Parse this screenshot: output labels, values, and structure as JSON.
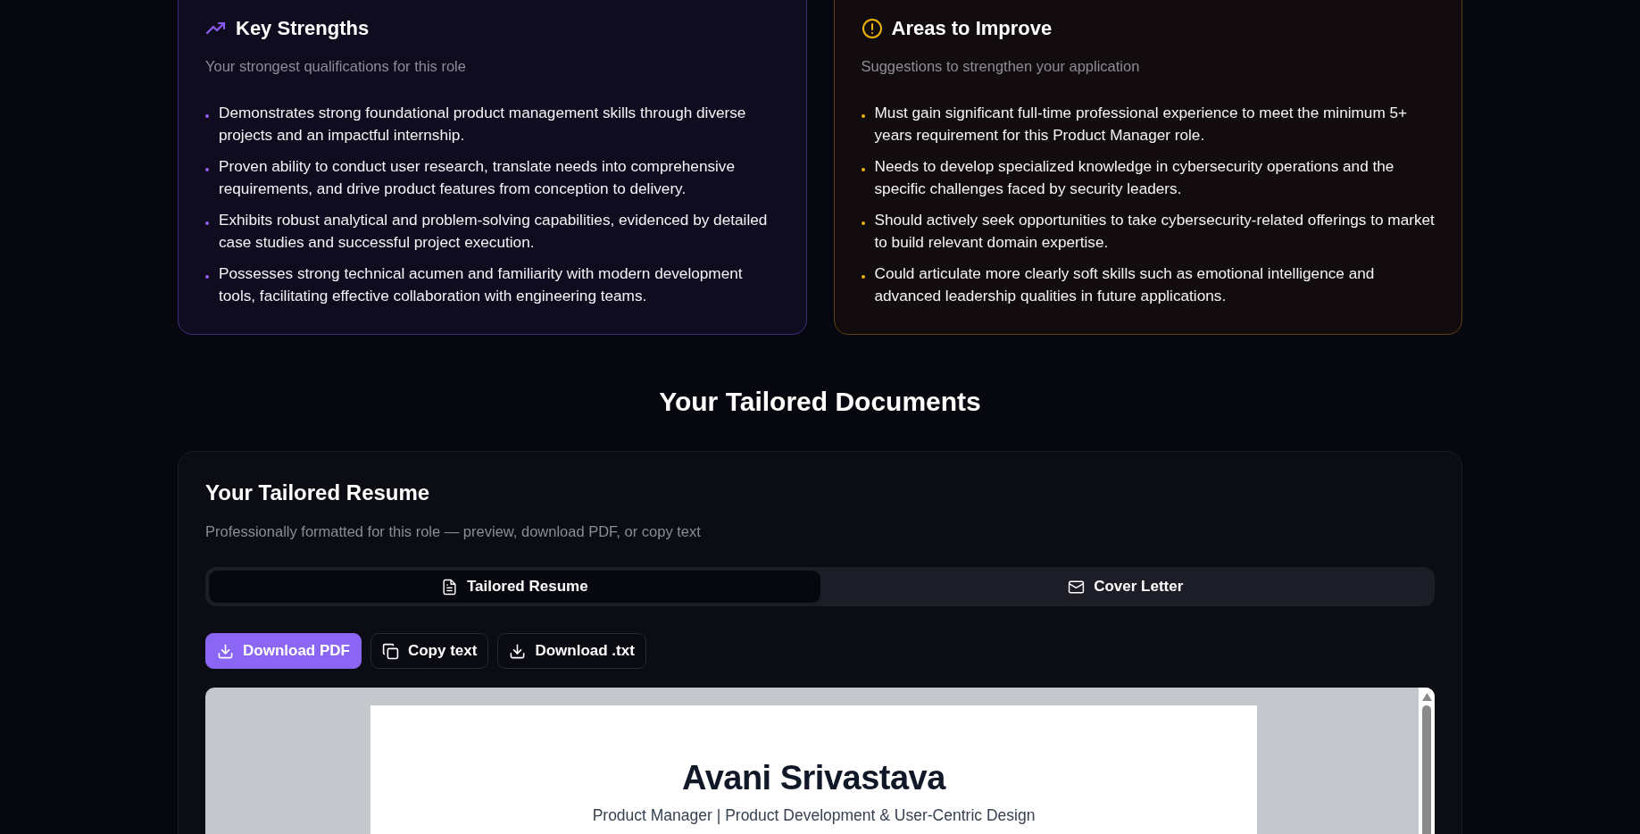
{
  "insight_cards": [
    {
      "kind": "strengths",
      "title": "Key Strengths",
      "subtitle": "Your strongest qualifications for this role",
      "items": [
        "Demonstrates strong foundational product management skills through diverse projects and an impactful internship.",
        "Proven ability to conduct user research, translate needs into comprehensive requirements, and drive product features from conception to delivery.",
        "Exhibits robust analytical and problem-solving capabilities, evidenced by detailed case studies and successful project execution.",
        "Possesses strong technical acumen and familiarity with modern development tools, facilitating effective collaboration with engineering teams."
      ]
    },
    {
      "kind": "improve",
      "title": "Areas to Improve",
      "subtitle": "Suggestions to strengthen your application",
      "items": [
        "Must gain significant full-time professional experience to meet the minimum 5+ years requirement for this Product Manager role.",
        "Needs to develop specialized knowledge in cybersecurity operations and the specific challenges faced by security leaders.",
        "Should actively seek opportunities to take cybersecurity-related offerings to market to build relevant domain expertise.",
        "Could articulate more clearly soft skills such as emotional intelligence and advanced leadership qualities in future applications."
      ]
    }
  ],
  "section_heading": "Your Tailored Documents",
  "documents": {
    "title": "Your Tailored Resume",
    "subtitle": "Professionally formatted for this role — preview, download PDF, or copy text",
    "tabs": [
      {
        "kind": "document",
        "label": "Tailored Resume",
        "selected": true
      },
      {
        "kind": "mail",
        "label": "Cover Letter",
        "selected": false
      }
    ],
    "actions": [
      {
        "kind": "download",
        "label": "Download PDF",
        "primary": true
      },
      {
        "kind": "copy",
        "label": "Copy text",
        "primary": false
      },
      {
        "kind": "download",
        "label": "Download .txt",
        "primary": false
      }
    ],
    "preview": {
      "name": "Avani Srivastava",
      "headline": "Product Manager | Product Development & User-Centric Design"
    }
  }
}
